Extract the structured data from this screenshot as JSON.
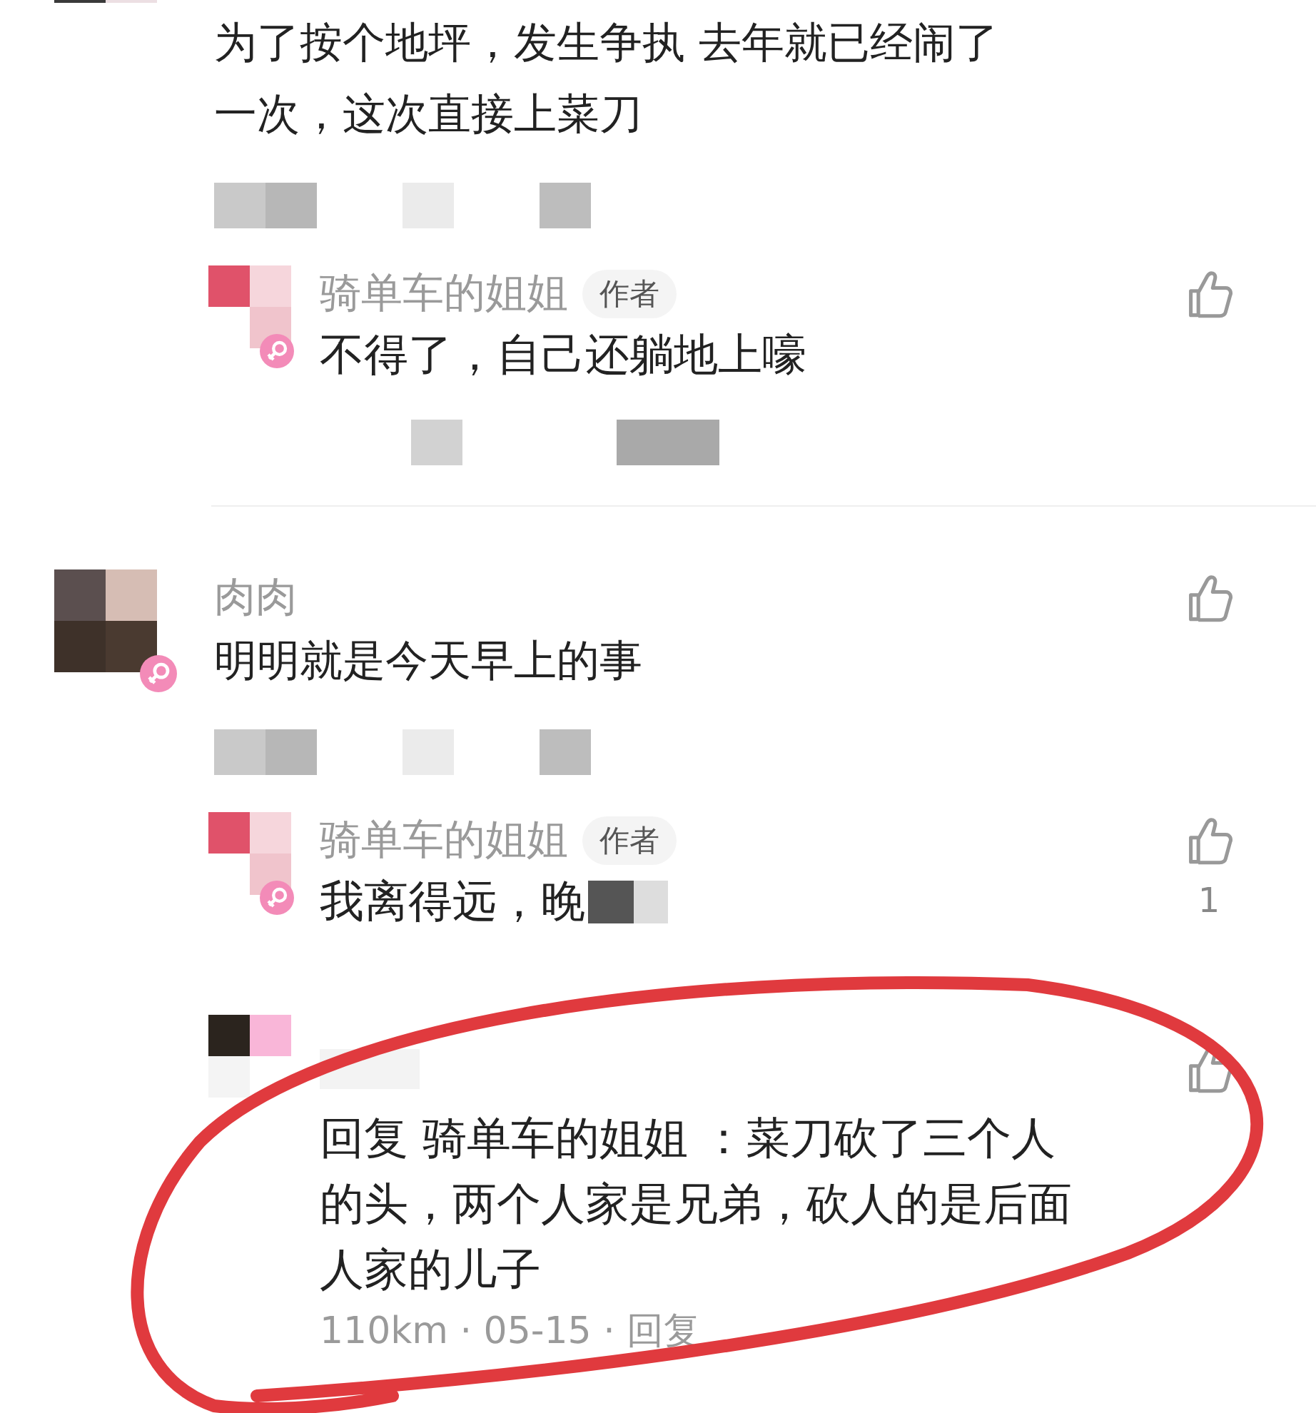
{
  "comments": [
    {
      "text": "为了按个地坪，发生争执 去年就已经闹了一次，这次直接上菜刀",
      "meta_censored": true,
      "replies": [
        {
          "name": "骑单车的姐姐",
          "badge": "作者",
          "text": "不得了，自己还躺地上嚎",
          "gender_badge": true,
          "meta_censored": true
        }
      ]
    },
    {
      "name": "肉肉",
      "text": "明明就是今天早上的事",
      "gender_badge": true,
      "meta_censored": true,
      "like_button": true,
      "replies": [
        {
          "name": "骑单车的姐姐",
          "badge": "作者",
          "text": "我离得远，晚",
          "gender_badge": true,
          "text_censored": true,
          "likes": "1"
        },
        {
          "text": "回复 骑单车的姐姐 ：菜刀砍了三个人的头，两个人家是兄弟，砍人的是后面人家的儿子",
          "name_censored": true,
          "meta": "110km · 05-15 · 回复"
        }
      ]
    }
  ],
  "annotation": {
    "kind": "circle"
  }
}
